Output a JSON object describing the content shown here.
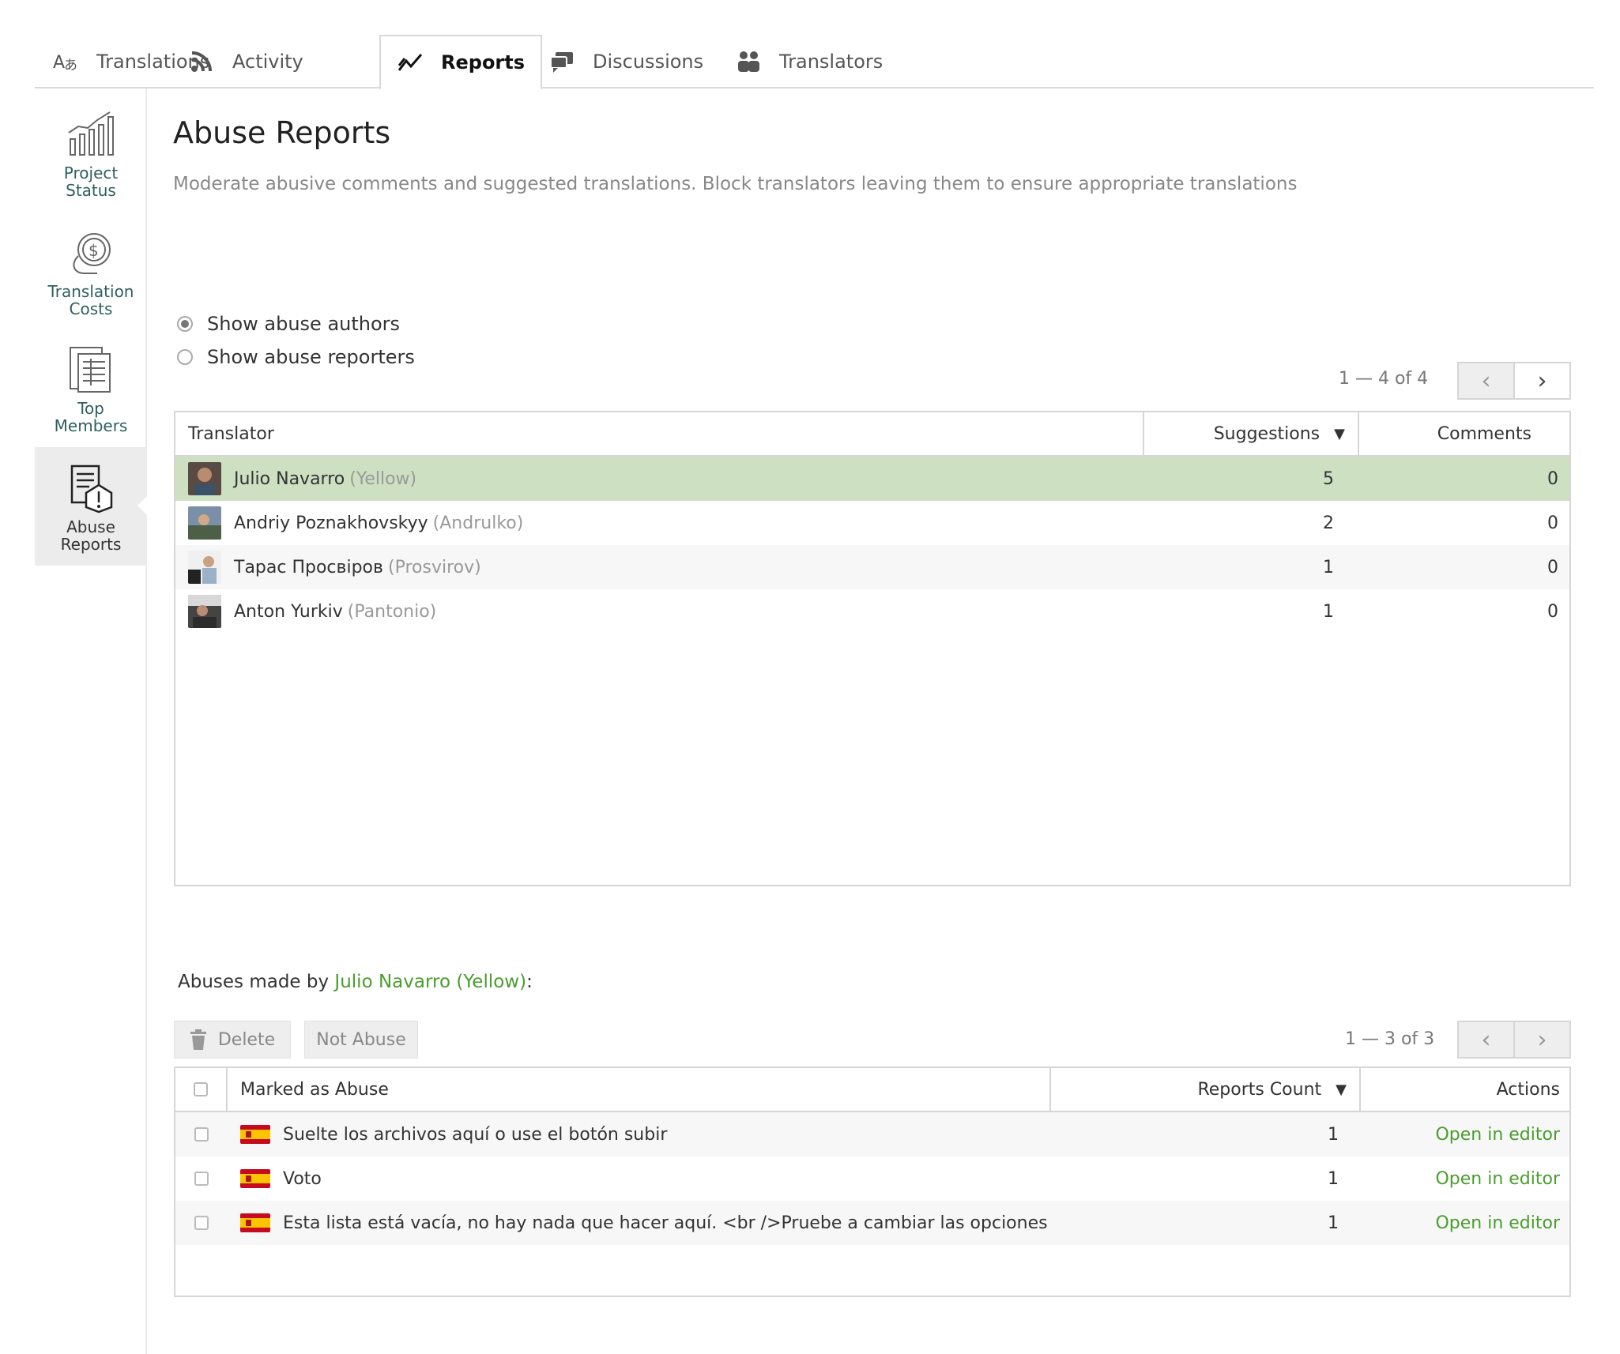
{
  "tabs": [
    {
      "label": "Translations",
      "icon": "translate-icon"
    },
    {
      "label": "Activity",
      "icon": "rss-icon"
    },
    {
      "label": "Reports",
      "icon": "chart-line-icon",
      "active": true
    },
    {
      "label": "Discussions",
      "icon": "chat-bubbles-icon"
    },
    {
      "label": "Translators",
      "icon": "people-icon"
    }
  ],
  "sidebar": {
    "items": [
      {
        "label": "Project Status",
        "icon": "bar-chart-icon"
      },
      {
        "label": "Translation Costs",
        "icon": "coins-icon"
      },
      {
        "label": "Top Members",
        "icon": "document-list-icon"
      },
      {
        "label": "Abuse Reports",
        "icon": "report-warning-icon",
        "active": true
      }
    ]
  },
  "page": {
    "title": "Abuse Reports",
    "description": "Moderate abusive comments and suggested translations. Block translators leaving them to ensure appropriate translations"
  },
  "filters": {
    "show_authors": "Show abuse authors",
    "show_reporters": "Show abuse reporters",
    "selected": "Show abuse authors"
  },
  "authors_table": {
    "pager": "1 — 4 of 4",
    "columns": {
      "translator": "Translator",
      "suggestions": "Suggestions",
      "comments": "Comments"
    },
    "sort_indicator": "▼",
    "rows": [
      {
        "name": "Julio Navarro",
        "nick": "(Yellow)",
        "suggestions": "5",
        "comments": "0",
        "selected": true
      },
      {
        "name": "Andriy Poznakhovskyy",
        "nick": "(Andrulko)",
        "suggestions": "2",
        "comments": "0"
      },
      {
        "name": "Тарас Просвіров",
        "nick": "(Prosvirov)",
        "suggestions": "1",
        "comments": "0"
      },
      {
        "name": "Anton Yurkiv",
        "nick": "(Pantonio)",
        "suggestions": "1",
        "comments": "0"
      }
    ]
  },
  "abuses": {
    "title_prefix": "Abuses made by ",
    "title_user": "Julio Navarro (Yellow)",
    "title_suffix": ":",
    "delete_label": "Delete",
    "not_abuse_label": "Not Abuse",
    "pager": "1 — 3 of 3",
    "columns": {
      "marked": "Marked as Abuse",
      "reports_count": "Reports Count",
      "actions": "Actions"
    },
    "sort_indicator": "▼",
    "rows": [
      {
        "text": "Suelte los archivos aquí o use el botón subir",
        "count": "1",
        "action": "Open in editor",
        "flag": "es"
      },
      {
        "text": "Voto",
        "count": "1",
        "action": "Open in editor",
        "flag": "es"
      },
      {
        "text": "Esta lista está vacía, no hay nada que hacer aquí. <br />Pruebe a cambiar las opciones de fil...",
        "count": "1",
        "action": "Open in editor",
        "flag": "es"
      }
    ]
  }
}
